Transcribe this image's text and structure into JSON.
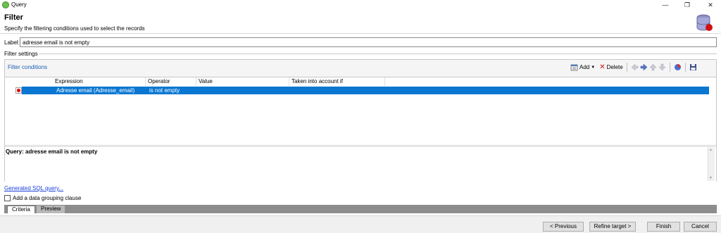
{
  "window": {
    "title": "Query",
    "minimize": "—",
    "restore": "❐",
    "close": "✕"
  },
  "header": {
    "title": "Filter",
    "subtitle": "Specify the filtering conditions used to select the records"
  },
  "label_field": {
    "caption": "Label:",
    "value": "adresse email is not empty"
  },
  "filter_settings": {
    "caption": "Filter settings"
  },
  "filter_conditions": {
    "title": "Filter conditions",
    "toolbar": {
      "add_label": "Add",
      "delete_label": "Delete"
    },
    "columns": [
      "Expression",
      "Operator",
      "Value",
      "Taken into account if"
    ],
    "rows": [
      {
        "expression": "Adresse email (Adresse_email)",
        "operator": "is not empty",
        "value": "",
        "condition": ""
      }
    ]
  },
  "query_preview": "Query: adresse email is not empty",
  "sql_link": "Generated SQL query...",
  "grouping_checkbox": {
    "label": "Add a data grouping clause",
    "checked": false
  },
  "tabs": [
    "Criteria",
    "Preview"
  ],
  "footer": {
    "previous": "< Previous",
    "refine": "Refine target >",
    "finish": "Finish",
    "cancel": "Cancel"
  }
}
